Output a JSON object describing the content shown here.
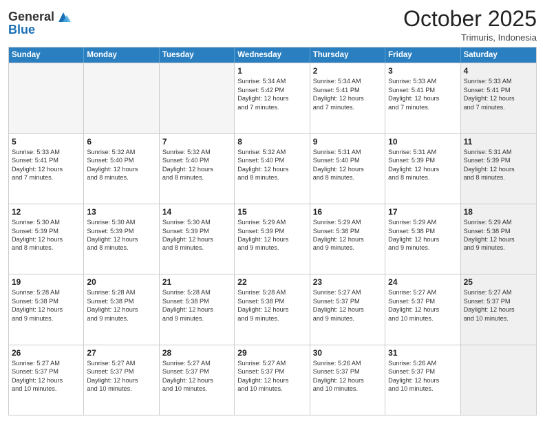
{
  "header": {
    "logo_general": "General",
    "logo_blue": "Blue",
    "month_title": "October 2025",
    "subtitle": "Trimuris, Indonesia"
  },
  "weekdays": [
    "Sunday",
    "Monday",
    "Tuesday",
    "Wednesday",
    "Thursday",
    "Friday",
    "Saturday"
  ],
  "rows": [
    [
      {
        "day": "",
        "text": "",
        "empty": true
      },
      {
        "day": "",
        "text": "",
        "empty": true
      },
      {
        "day": "",
        "text": "",
        "empty": true
      },
      {
        "day": "1",
        "text": "Sunrise: 5:34 AM\nSunset: 5:42 PM\nDaylight: 12 hours\nand 7 minutes."
      },
      {
        "day": "2",
        "text": "Sunrise: 5:34 AM\nSunset: 5:41 PM\nDaylight: 12 hours\nand 7 minutes."
      },
      {
        "day": "3",
        "text": "Sunrise: 5:33 AM\nSunset: 5:41 PM\nDaylight: 12 hours\nand 7 minutes."
      },
      {
        "day": "4",
        "text": "Sunrise: 5:33 AM\nSunset: 5:41 PM\nDaylight: 12 hours\nand 7 minutes.",
        "shaded": true
      }
    ],
    [
      {
        "day": "5",
        "text": "Sunrise: 5:33 AM\nSunset: 5:41 PM\nDaylight: 12 hours\nand 7 minutes."
      },
      {
        "day": "6",
        "text": "Sunrise: 5:32 AM\nSunset: 5:40 PM\nDaylight: 12 hours\nand 8 minutes."
      },
      {
        "day": "7",
        "text": "Sunrise: 5:32 AM\nSunset: 5:40 PM\nDaylight: 12 hours\nand 8 minutes."
      },
      {
        "day": "8",
        "text": "Sunrise: 5:32 AM\nSunset: 5:40 PM\nDaylight: 12 hours\nand 8 minutes."
      },
      {
        "day": "9",
        "text": "Sunrise: 5:31 AM\nSunset: 5:40 PM\nDaylight: 12 hours\nand 8 minutes."
      },
      {
        "day": "10",
        "text": "Sunrise: 5:31 AM\nSunset: 5:39 PM\nDaylight: 12 hours\nand 8 minutes."
      },
      {
        "day": "11",
        "text": "Sunrise: 5:31 AM\nSunset: 5:39 PM\nDaylight: 12 hours\nand 8 minutes.",
        "shaded": true
      }
    ],
    [
      {
        "day": "12",
        "text": "Sunrise: 5:30 AM\nSunset: 5:39 PM\nDaylight: 12 hours\nand 8 minutes."
      },
      {
        "day": "13",
        "text": "Sunrise: 5:30 AM\nSunset: 5:39 PM\nDaylight: 12 hours\nand 8 minutes."
      },
      {
        "day": "14",
        "text": "Sunrise: 5:30 AM\nSunset: 5:39 PM\nDaylight: 12 hours\nand 8 minutes."
      },
      {
        "day": "15",
        "text": "Sunrise: 5:29 AM\nSunset: 5:39 PM\nDaylight: 12 hours\nand 9 minutes."
      },
      {
        "day": "16",
        "text": "Sunrise: 5:29 AM\nSunset: 5:38 PM\nDaylight: 12 hours\nand 9 minutes."
      },
      {
        "day": "17",
        "text": "Sunrise: 5:29 AM\nSunset: 5:38 PM\nDaylight: 12 hours\nand 9 minutes."
      },
      {
        "day": "18",
        "text": "Sunrise: 5:29 AM\nSunset: 5:38 PM\nDaylight: 12 hours\nand 9 minutes.",
        "shaded": true
      }
    ],
    [
      {
        "day": "19",
        "text": "Sunrise: 5:28 AM\nSunset: 5:38 PM\nDaylight: 12 hours\nand 9 minutes."
      },
      {
        "day": "20",
        "text": "Sunrise: 5:28 AM\nSunset: 5:38 PM\nDaylight: 12 hours\nand 9 minutes."
      },
      {
        "day": "21",
        "text": "Sunrise: 5:28 AM\nSunset: 5:38 PM\nDaylight: 12 hours\nand 9 minutes."
      },
      {
        "day": "22",
        "text": "Sunrise: 5:28 AM\nSunset: 5:38 PM\nDaylight: 12 hours\nand 9 minutes."
      },
      {
        "day": "23",
        "text": "Sunrise: 5:27 AM\nSunset: 5:37 PM\nDaylight: 12 hours\nand 9 minutes."
      },
      {
        "day": "24",
        "text": "Sunrise: 5:27 AM\nSunset: 5:37 PM\nDaylight: 12 hours\nand 10 minutes."
      },
      {
        "day": "25",
        "text": "Sunrise: 5:27 AM\nSunset: 5:37 PM\nDaylight: 12 hours\nand 10 minutes.",
        "shaded": true
      }
    ],
    [
      {
        "day": "26",
        "text": "Sunrise: 5:27 AM\nSunset: 5:37 PM\nDaylight: 12 hours\nand 10 minutes."
      },
      {
        "day": "27",
        "text": "Sunrise: 5:27 AM\nSunset: 5:37 PM\nDaylight: 12 hours\nand 10 minutes."
      },
      {
        "day": "28",
        "text": "Sunrise: 5:27 AM\nSunset: 5:37 PM\nDaylight: 12 hours\nand 10 minutes."
      },
      {
        "day": "29",
        "text": "Sunrise: 5:27 AM\nSunset: 5:37 PM\nDaylight: 12 hours\nand 10 minutes."
      },
      {
        "day": "30",
        "text": "Sunrise: 5:26 AM\nSunset: 5:37 PM\nDaylight: 12 hours\nand 10 minutes."
      },
      {
        "day": "31",
        "text": "Sunrise: 5:26 AM\nSunset: 5:37 PM\nDaylight: 12 hours\nand 10 minutes."
      },
      {
        "day": "",
        "text": "",
        "empty": true,
        "shaded": true
      }
    ]
  ]
}
